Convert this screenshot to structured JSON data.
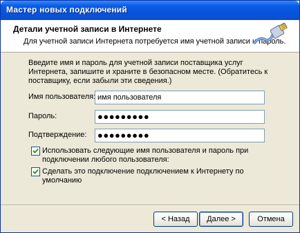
{
  "window": {
    "title": "Мастер новых подключений"
  },
  "header": {
    "title": "Детали учетной записи в Интернете",
    "subtitle": "Для учетной записи Интернета потребуется имя учетной записи и пароль.",
    "icon": "network-cable-icon"
  },
  "content": {
    "intro": "Введите имя и пароль для учетной записи поставщика услуг Интернета, запишите и храните в безопасном месте. (Обратитесь к поставщику, если забыли эти сведения.)",
    "username": {
      "label": "Имя пользователя:",
      "value": "имя пользователя"
    },
    "password": {
      "label": "Пароль:",
      "value": "●●●●●●●●●"
    },
    "confirm": {
      "label": "Подтверждение:",
      "value": "●●●●●●●●●"
    },
    "checkbox_all_users": {
      "label": "Использовать следующие имя пользователя и пароль при подключении любого пользователя:",
      "checked": true
    },
    "checkbox_default": {
      "label": "Сделать это подключение подключением к Интернету по умолчанию",
      "checked": true
    }
  },
  "buttons": {
    "back": "< Назад",
    "next": "Далее >",
    "cancel": "Отмена"
  },
  "colors": {
    "titlebar": "#0a5ee8",
    "dialog_bg": "#ece9d8",
    "check_mark": "#21a121"
  }
}
